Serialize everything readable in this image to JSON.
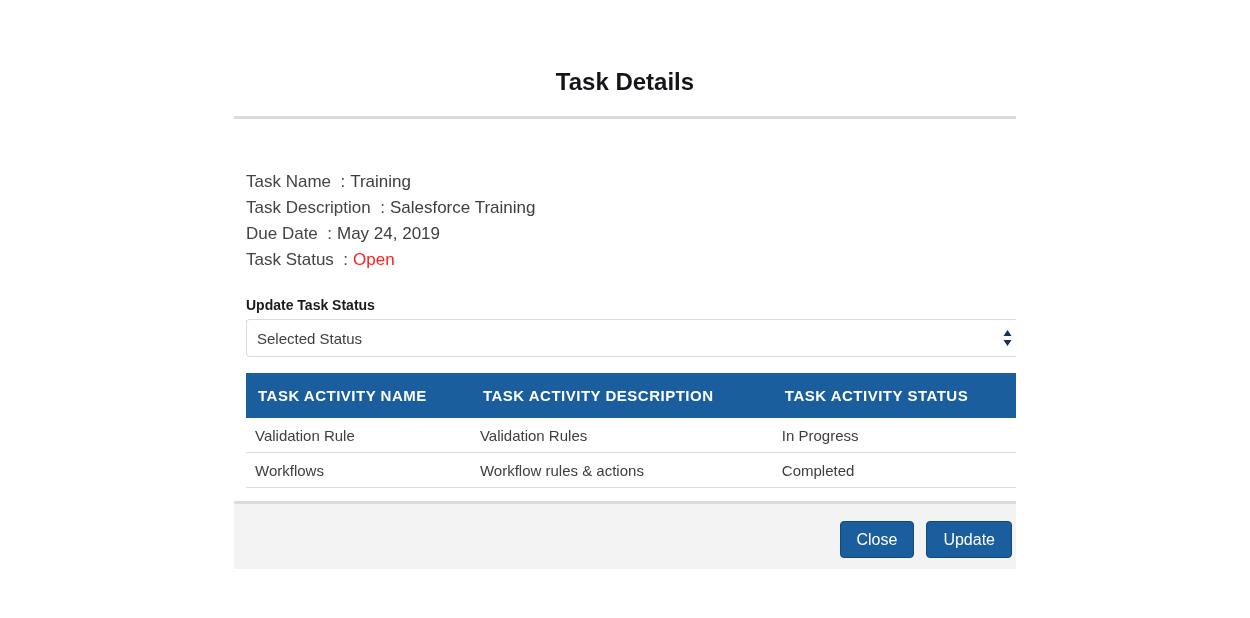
{
  "modal": {
    "title": "Task Details"
  },
  "details": [
    {
      "label": "Task Name  :",
      "value": "Training",
      "color": "#3e3e3c"
    },
    {
      "label": "Task Description  :",
      "value": "Salesforce Training",
      "color": "#3e3e3c"
    },
    {
      "label": "Due Date  :",
      "value": "May 24, 2019",
      "color": "#3e3e3c"
    },
    {
      "label": "Task Status  :",
      "value": "Open",
      "color": "#ff2020"
    }
  ],
  "status_select": {
    "label": "Update Task Status",
    "value": "Selected Status"
  },
  "table": {
    "columns": [
      "TASK ACTIVITY NAME",
      "TASK ACTIVITY DESCRIPTION",
      "TASK ACTIVITY STATUS"
    ],
    "rows": [
      [
        "Validation Rule",
        "Validation Rules",
        "In Progress"
      ],
      [
        "Workflows",
        "Workflow rules & actions",
        "Completed"
      ]
    ]
  },
  "buttons": [
    "Close",
    "Update"
  ]
}
